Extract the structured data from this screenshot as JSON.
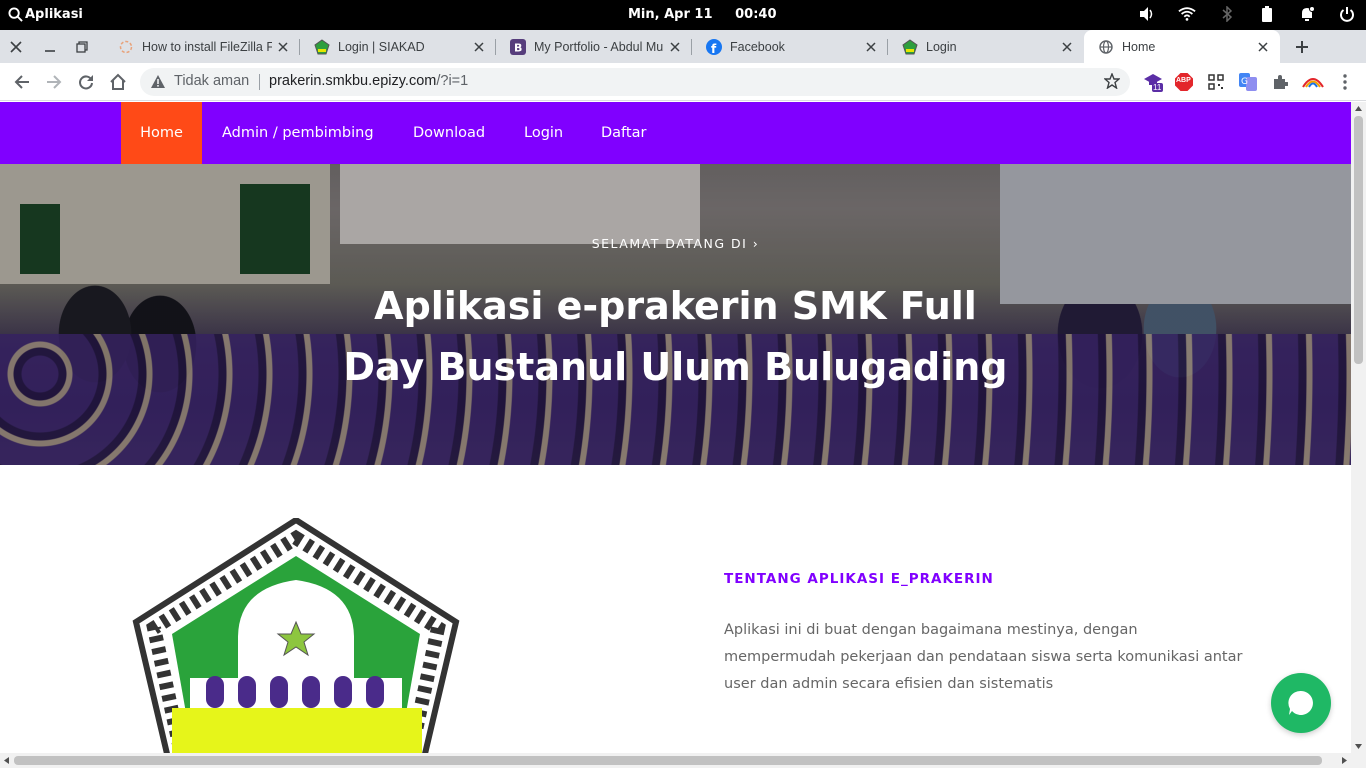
{
  "os": {
    "apps_label": "Aplikasi",
    "clock": "Min, Apr 11     00:40"
  },
  "tabs": [
    {
      "title": "How to install FileZilla F",
      "favicon": "spinner-icon"
    },
    {
      "title": "Login | SIAKAD",
      "favicon": "school-logo-icon"
    },
    {
      "title": "My Portfolio - Abdul Mu",
      "favicon": "bootstrap-icon"
    },
    {
      "title": "Facebook",
      "favicon": "facebook-icon"
    },
    {
      "title": "Login",
      "favicon": "school-logo-icon"
    },
    {
      "title": "Home",
      "favicon": "globe-icon",
      "active": true
    }
  ],
  "address": {
    "security_label": "Tidak aman",
    "host": "prakerin.smkbu.epizy.com",
    "path": "/?i=1"
  },
  "extensions": {
    "badge_count": "11",
    "abp_label": "ABP"
  },
  "site": {
    "nav": [
      {
        "label": "Home",
        "active": true
      },
      {
        "label": "Admin / pembimbing"
      },
      {
        "label": "Download"
      },
      {
        "label": "Login"
      },
      {
        "label": "Daftar"
      }
    ],
    "hero": {
      "eyebrow": "SELAMAT DATANG DI",
      "title": "Aplikasi e-prakerin SMK Full Day Bustanul Ulum Bulugading"
    },
    "about": {
      "title": "TENTANG APLIKASI E_PRAKERIN",
      "text": "Aplikasi ini di buat dengan bagaimana mestinya, dengan mempermudah pekerjaan dan pendataan siswa serta komunikasi antar user dan admin secara efisien dan sistematis"
    }
  },
  "colors": {
    "nav_bg": "#8000ff",
    "nav_active": "#ff4a17",
    "chat_button": "#1fb865",
    "about_title": "#8000ff"
  }
}
